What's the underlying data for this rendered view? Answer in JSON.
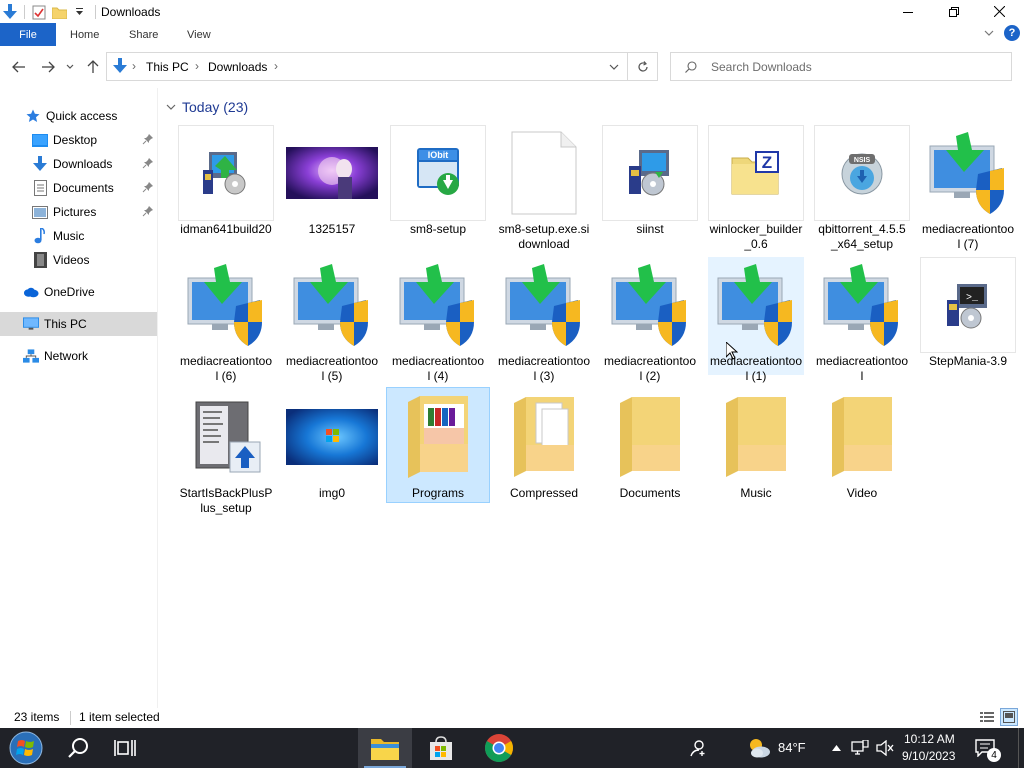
{
  "window": {
    "title": "Downloads",
    "controls": {
      "minimize": "minimize",
      "maximize": "restore",
      "close": "close"
    }
  },
  "ribbon": {
    "tabs": [
      "File",
      "Home",
      "Share",
      "View"
    ]
  },
  "address": {
    "crumbs": [
      "This PC",
      "Downloads"
    ],
    "search_placeholder": "Search Downloads"
  },
  "nav": {
    "items": [
      {
        "label": "Quick access",
        "icon": "star-icon"
      },
      {
        "label": "Desktop",
        "icon": "desktop-icon",
        "pinned": true
      },
      {
        "label": "Downloads",
        "icon": "download-arrow-icon",
        "pinned": true
      },
      {
        "label": "Documents",
        "icon": "document-icon",
        "pinned": true
      },
      {
        "label": "Pictures",
        "icon": "pictures-icon",
        "pinned": true
      },
      {
        "label": "Music",
        "icon": "music-note-icon"
      },
      {
        "label": "Videos",
        "icon": "film-icon"
      },
      {
        "label": "OneDrive",
        "icon": "cloud-icon"
      },
      {
        "label": "This PC",
        "icon": "monitor-icon",
        "selected": true
      },
      {
        "label": "Network",
        "icon": "network-icon"
      }
    ]
  },
  "group": {
    "header": "Today (23)"
  },
  "files": [
    {
      "label": "idman641build20",
      "icon": "installer-icon"
    },
    {
      "label": "1325157",
      "icon": "image-thumbnail-anime"
    },
    {
      "label": "sm8-setup",
      "icon": "iobit-installer-icon"
    },
    {
      "label": "sm8-setup.exe.sidownload",
      "icon": "blank-file-icon"
    },
    {
      "label": "siinst",
      "icon": "installer-cd-icon"
    },
    {
      "label": "winlocker_builder_0.6",
      "icon": "zip-archive-icon"
    },
    {
      "label": "qbittorrent_4.5.5_x64_setup",
      "icon": "nsis-installer-icon"
    },
    {
      "label": "mediacreationtool (7)",
      "icon": "media-creation-tool-icon"
    },
    {
      "label": "mediacreationtool (6)",
      "icon": "media-creation-tool-icon"
    },
    {
      "label": "mediacreationtool (5)",
      "icon": "media-creation-tool-icon"
    },
    {
      "label": "mediacreationtool (4)",
      "icon": "media-creation-tool-icon"
    },
    {
      "label": "mediacreationtool (3)",
      "icon": "media-creation-tool-icon"
    },
    {
      "label": "mediacreationtool (2)",
      "icon": "media-creation-tool-icon"
    },
    {
      "label": "mediacreationtool (1)",
      "icon": "media-creation-tool-icon",
      "state": "hover"
    },
    {
      "label": "mediacreationtool",
      "icon": "media-creation-tool-icon"
    },
    {
      "label": "StepMania-3.9",
      "icon": "installer-terminal-icon"
    },
    {
      "label": "StartIsBackPlusPlus_setup",
      "icon": "startisback-installer-icon"
    },
    {
      "label": "img0",
      "icon": "image-thumbnail-windows7"
    },
    {
      "label": "Programs",
      "icon": "folder-books-icon",
      "state": "selected"
    },
    {
      "label": "Compressed",
      "icon": "folder-documents-icon"
    },
    {
      "label": "Documents",
      "icon": "folder-icon"
    },
    {
      "label": "Music",
      "icon": "folder-icon"
    },
    {
      "label": "Video",
      "icon": "folder-icon"
    }
  ],
  "status": {
    "item_count": "23 items",
    "selection": "1 item selected"
  },
  "taskbar": {
    "weather_temp": "84°F",
    "time": "10:12 AM",
    "date": "9/10/2023",
    "notification_count": "4"
  },
  "colors": {
    "accent": "#1c64c8",
    "selected_tile": "#cce8ff",
    "hover_tile": "#e5f3ff",
    "taskbar": "#202228"
  }
}
